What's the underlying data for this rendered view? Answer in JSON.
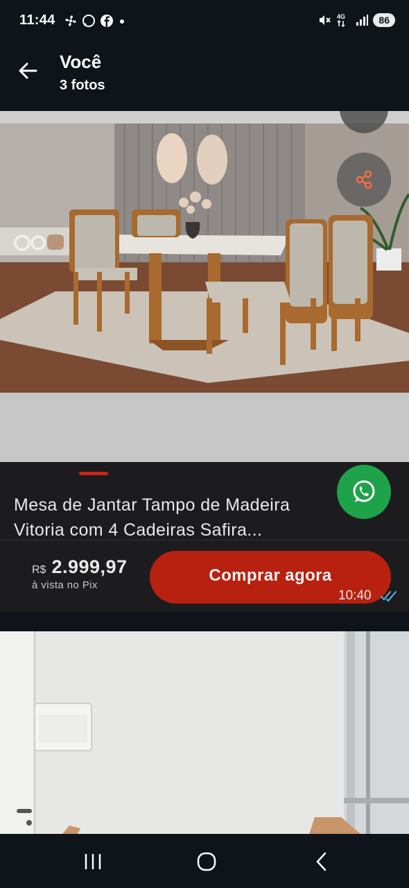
{
  "status_bar": {
    "time": "11:44",
    "network": "4G",
    "battery": "86",
    "left_icons": [
      "fan-icon",
      "whatsapp-icon",
      "facebook-icon",
      "dot-icon"
    ],
    "right_icons": [
      "mute-icon",
      "data-icon",
      "signal-icon"
    ]
  },
  "header": {
    "title": "Você",
    "subtitle": "3 fotos"
  },
  "product": {
    "title": "Mesa de Jantar Tampo de Madeira Vitoria com 4 Cadeiras Safira...",
    "currency": "R$",
    "price": "2.999,97",
    "payment_note": "à vista no Pix",
    "buy_label": "Comprar agora"
  },
  "message": {
    "time": "10:40",
    "status": "read"
  },
  "colors": {
    "background": "#0e1419",
    "card": "#1c1c1e",
    "buy_button": "#b8210f",
    "whatsapp_green": "#1ea34a",
    "read_ticks": "#53bdeb"
  }
}
